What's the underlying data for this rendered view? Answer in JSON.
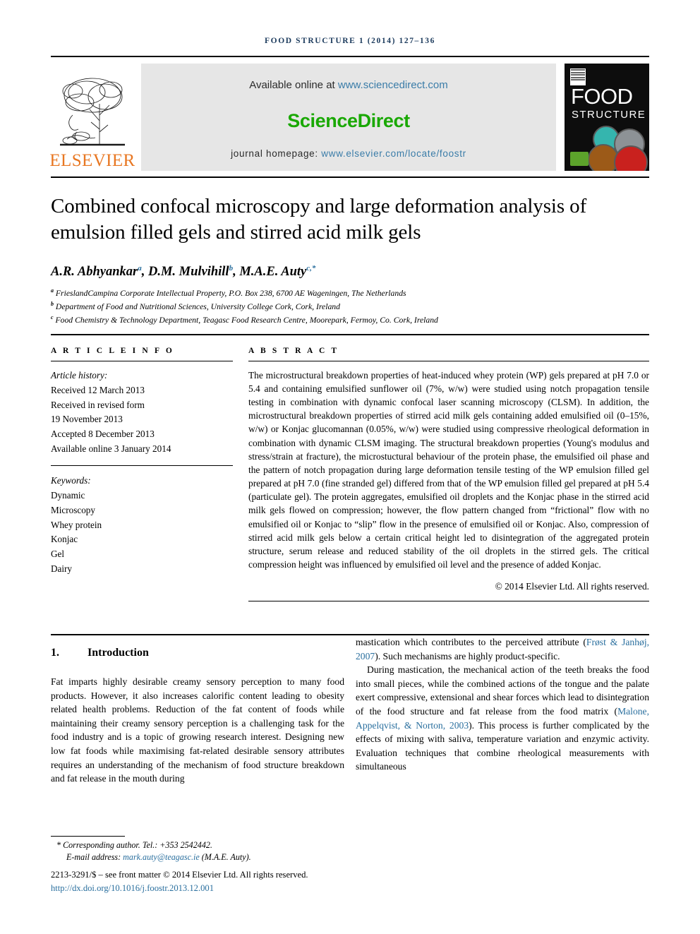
{
  "running_head": "FOOD STRUCTURE 1 (2014) 127–136",
  "masthead": {
    "publisher_name": "ELSEVIER",
    "available_prefix": "Available online at ",
    "available_url": "www.sciencedirect.com",
    "sciencedirect_logo": "ScienceDirect",
    "homepage_prefix": "journal homepage: ",
    "homepage_url": "www.elsevier.com/locate/foostr",
    "cover": {
      "line1": "FOOD",
      "line2": "STRUCTURE"
    }
  },
  "article": {
    "title": "Combined confocal microscopy and large deformation analysis of emulsion filled gels and stirred acid milk gels",
    "authors": [
      {
        "name": "A.R. Abhyankar",
        "sup": "a"
      },
      {
        "name": "D.M. Mulvihill",
        "sup": "b"
      },
      {
        "name": "M.A.E. Auty",
        "sup": "c,*"
      }
    ],
    "authors_line": "A.R. Abhyankar a, D.M. Mulvihill b, M.A.E. Auty c,*",
    "affiliations": [
      {
        "mark": "a",
        "text": "FrieslandCampina Corporate Intellectual Property, P.O. Box 238, 6700 AE Wageningen, The Netherlands"
      },
      {
        "mark": "b",
        "text": "Department of Food and Nutritional Sciences, University College Cork, Cork, Ireland"
      },
      {
        "mark": "c",
        "text": "Food Chemistry & Technology Department, Teagasc Food Research Centre, Moorepark, Fermoy, Co. Cork, Ireland"
      }
    ]
  },
  "article_info": {
    "heading": "A R T I C L E   I N F O",
    "history_label": "Article history:",
    "history": [
      "Received 12 March 2013",
      "Received in revised form",
      "19 November 2013",
      "Accepted 8 December 2013",
      "Available online 3 January 2014"
    ],
    "keywords_label": "Keywords:",
    "keywords": [
      "Dynamic",
      "Microscopy",
      "Whey protein",
      "Konjac",
      "Gel",
      "Dairy"
    ]
  },
  "abstract": {
    "heading": "A B S T R A C T",
    "text": "The microstructural breakdown properties of heat-induced whey protein (WP) gels prepared at pH 7.0 or 5.4 and containing emulsified sunflower oil (7%, w/w) were studied using notch propagation tensile testing in combination with dynamic confocal laser scanning microscopy (CLSM). In addition, the microstructural breakdown properties of stirred acid milk gels containing added emulsified oil (0–15%, w/w) or Konjac glucomannan (0.05%, w/w) were studied using compressive rheological deformation in combination with dynamic CLSM imaging. The structural breakdown properties (Young's modulus and stress/strain at fracture), the microstuctural behaviour of the protein phase, the emulsified oil phase and the pattern of notch propagation during large deformation tensile testing of the WP emulsion filled gel prepared at pH 7.0 (fine stranded gel) differed from that of the WP emulsion filled gel prepared at pH 5.4 (particulate gel). The protein aggregates, emulsified oil droplets and the Konjac phase in the stirred acid milk gels flowed on compression; however, the flow pattern changed from “frictional” flow with no emulsified oil or Konjac to “slip” flow in the presence of emulsified oil or Konjac. Also, compression of stirred acid milk gels below a certain critical height led to disintegration of the aggregated protein structure, serum release and reduced stability of the oil droplets in the stirred gels. The critical compression height was influenced by emulsified oil level and the presence of added Konjac.",
    "copyright": "© 2014 Elsevier Ltd. All rights reserved."
  },
  "body": {
    "section_number": "1.",
    "section_title": "Introduction",
    "left_paragraph": "Fat imparts highly desirable creamy sensory perception to many food products. However, it also increases calorific content leading to obesity related health problems. Reduction of the fat content of foods while maintaining their creamy sensory perception is a challenging task for the food industry and is a topic of growing research interest. Designing new low fat foods while maximising fat-related desirable sensory attributes requires an understanding of the mechanism of food structure breakdown and fat release in the mouth during",
    "right_p1_a": "mastication which contributes to the perceived attribute (",
    "right_p1_cite": "Frøst & Janhøj, 2007",
    "right_p1_b": "). Such mechanisms are highly product-specific.",
    "right_p2_a": "During mastication, the mechanical action of the teeth breaks the food into small pieces, while the combined actions of the tongue and the palate exert compressive, extensional and shear forces which lead to disintegration of the food structure and fat release from the food matrix (",
    "right_p2_cite": "Malone, Appelqvist, & Norton, 2003",
    "right_p2_b": "). This process is further complicated by the effects of mixing with saliva, temperature variation and enzymic activity. Evaluation techniques that combine rheological measurements with simultaneous"
  },
  "footnote": {
    "corresponding": "* Corresponding author. Tel.: +353 2542442.",
    "email_label": "E-mail address: ",
    "email": "mark.auty@teagasc.ie",
    "email_suffix": " (M.A.E. Auty).",
    "frontmatter": "2213-3291/$ – see front matter © 2014 Elsevier Ltd. All rights reserved.",
    "doi": "http://dx.doi.org/10.1016/j.foostr.2013.12.001"
  },
  "colors": {
    "link_blue": "#2a6f9e",
    "elsevier_orange": "#e87722",
    "sciencedirect_green": "#19a802",
    "runhead_blue": "#1b3a5c"
  }
}
